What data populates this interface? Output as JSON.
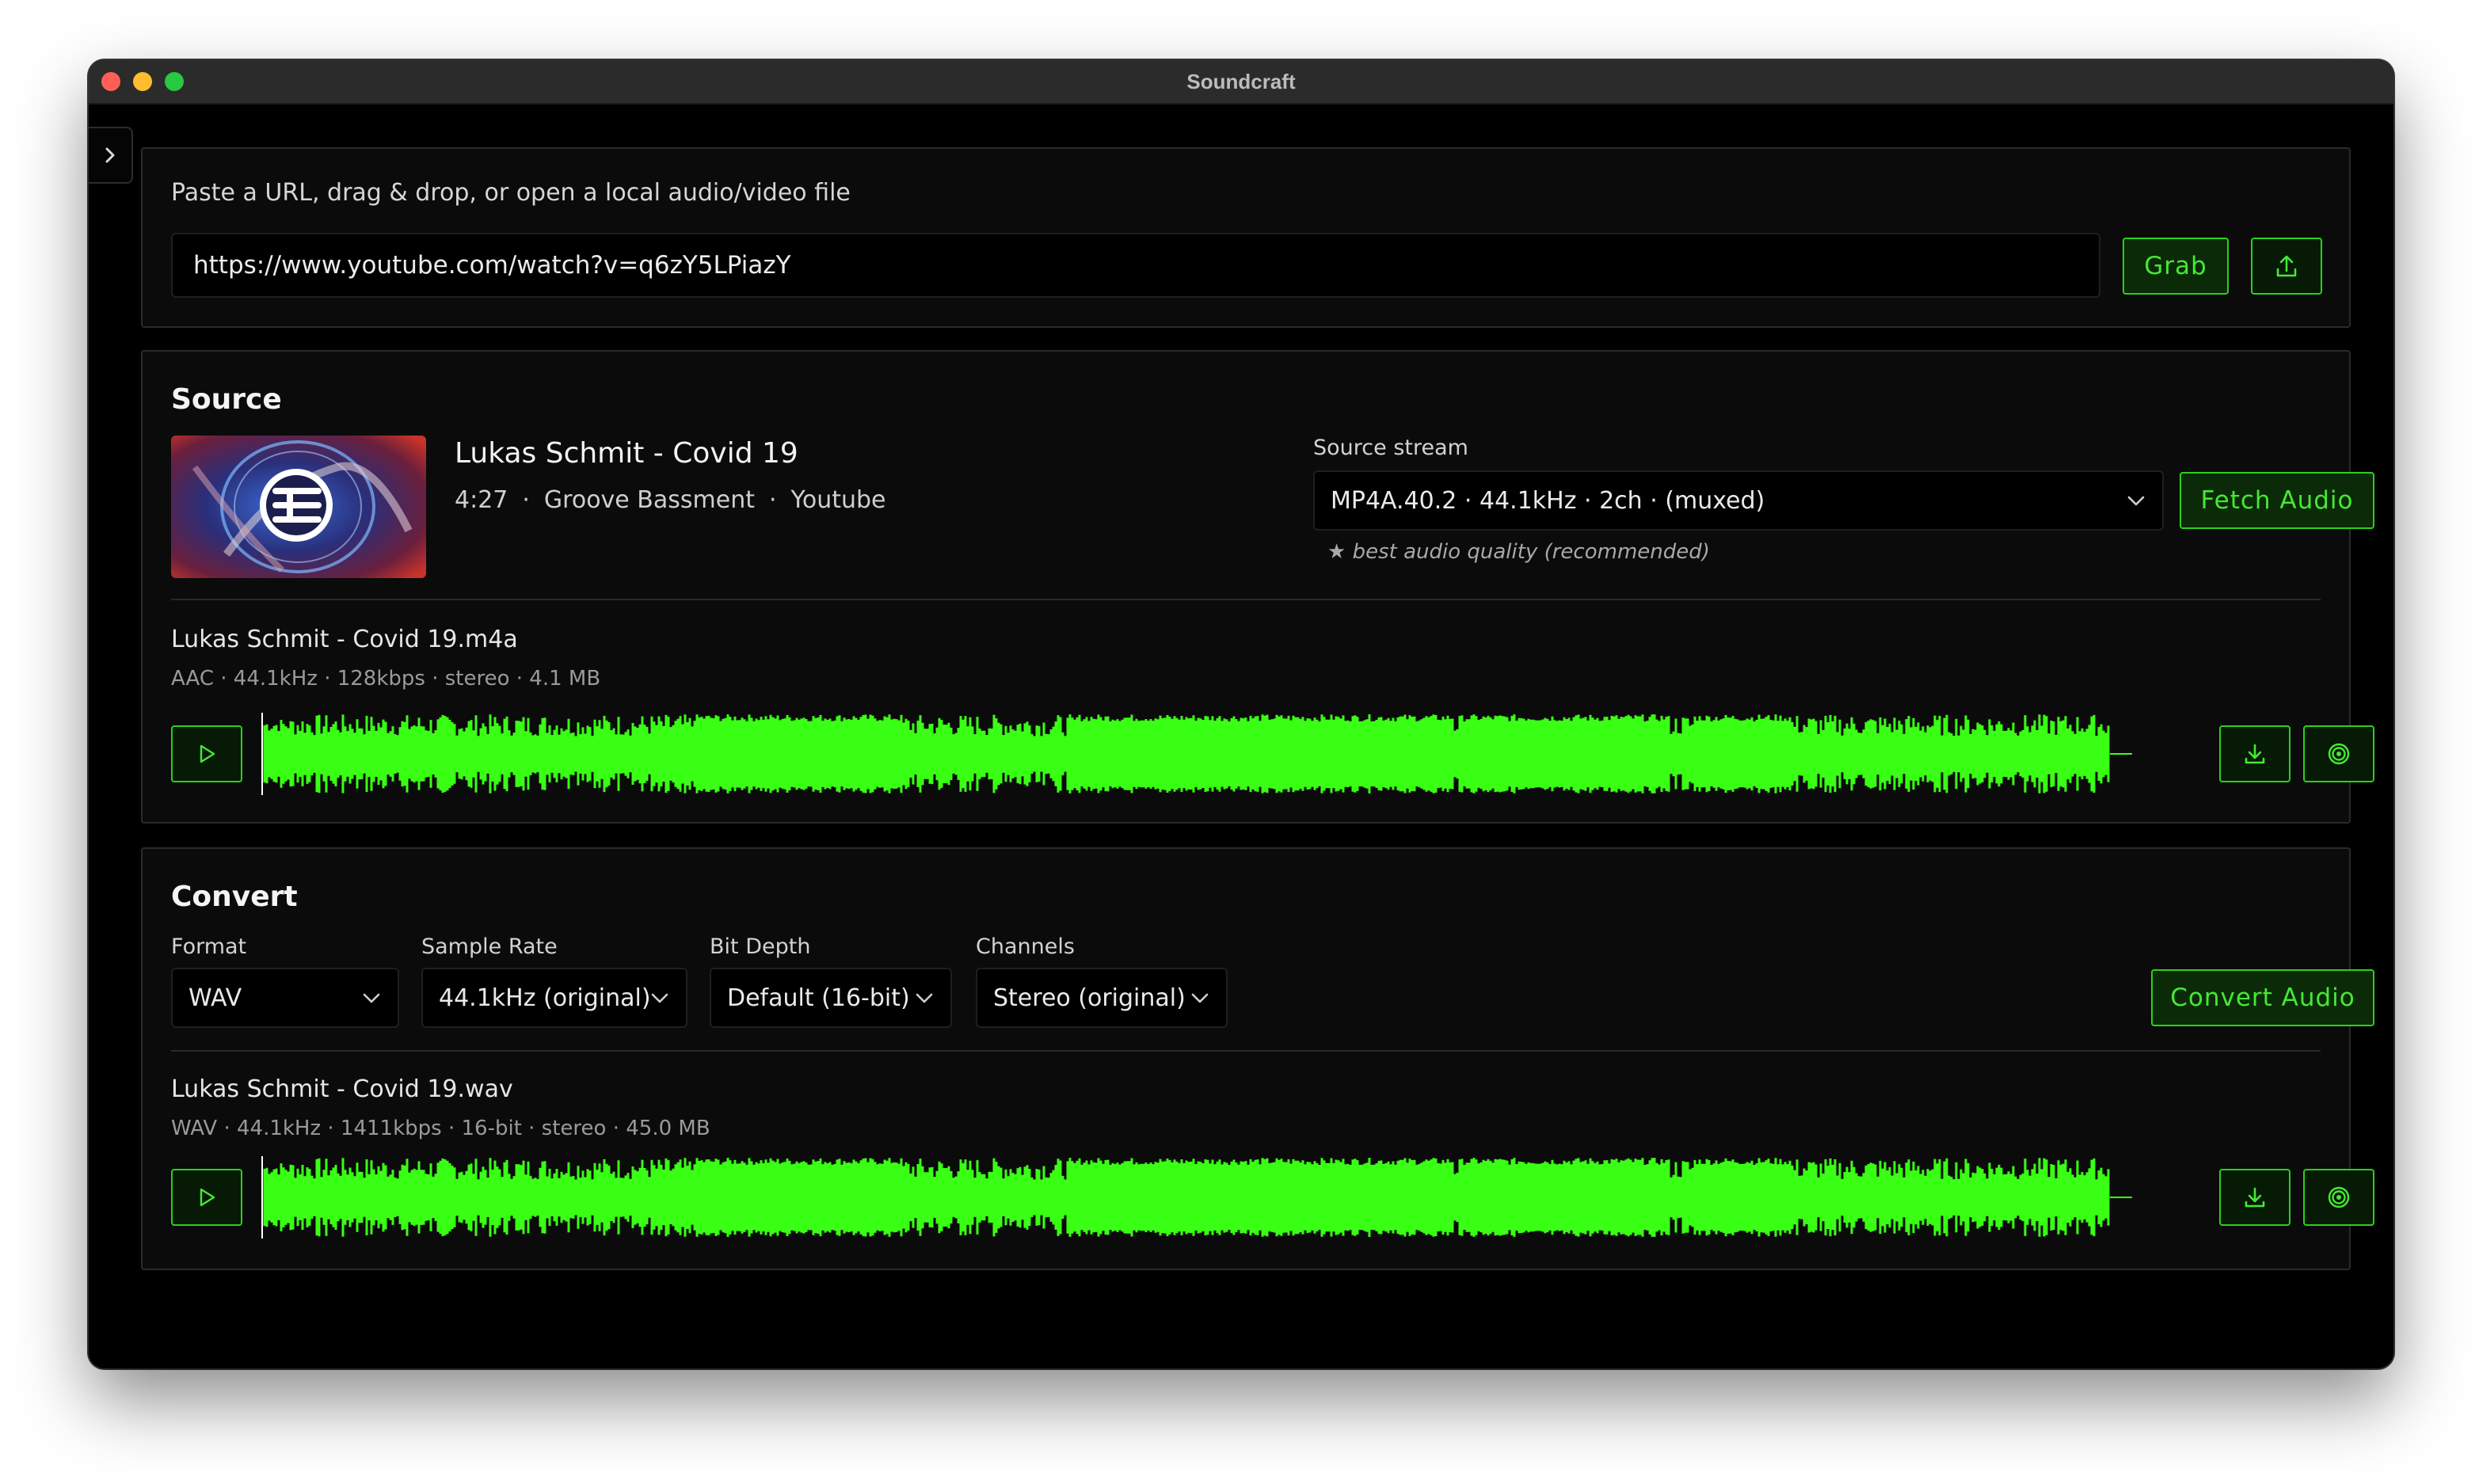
{
  "window": {
    "title": "Soundcraft"
  },
  "url_panel": {
    "label": "Paste a URL, drag & drop, or open a local audio/video file",
    "url_value": "https://www.youtube.com/watch?v=q6zY5LPiazY",
    "grab_label": "Grab"
  },
  "source": {
    "heading": "Source",
    "track_title": "Lukas Schmit - Covid 19",
    "duration": "4:27",
    "channel": "Groove Bassment",
    "platform": "Youtube",
    "separator": "·",
    "stream_label": "Source stream",
    "stream_value": "MP4A.40.2 · 44.1kHz · 2ch · (muxed)",
    "stream_hint": "★ best audio quality (recommended)",
    "fetch_label": "Fetch Audio",
    "file_name": "Lukas Schmit - Covid 19.m4a",
    "file_meta": "AAC · 44.1kHz · 128kbps · stereo · 4.1 MB"
  },
  "convert": {
    "heading": "Convert",
    "format_label": "Format",
    "format_value": "WAV",
    "sample_rate_label": "Sample Rate",
    "sample_rate_value": "44.1kHz (original)",
    "bit_depth_label": "Bit Depth",
    "bit_depth_value": "Default (16-bit)",
    "channels_label": "Channels",
    "channels_value": "Stereo (original)",
    "convert_label": "Convert Audio",
    "file_name": "Lukas Schmit - Covid 19.wav",
    "file_meta": "WAV · 44.1kHz · 1411kbps · 16-bit · stereo · 45.0 MB"
  },
  "icons": {
    "sidebar_toggle": "chevron-right-icon",
    "upload": "upload-icon",
    "dropdown": "chevron-down-icon",
    "play": "play-icon",
    "download": "download-icon",
    "analyze": "target-icon"
  },
  "colors": {
    "accent": "#2ad11a",
    "waveform": "#39ff14",
    "background": "#000000",
    "panel": "#0b0b0b"
  }
}
